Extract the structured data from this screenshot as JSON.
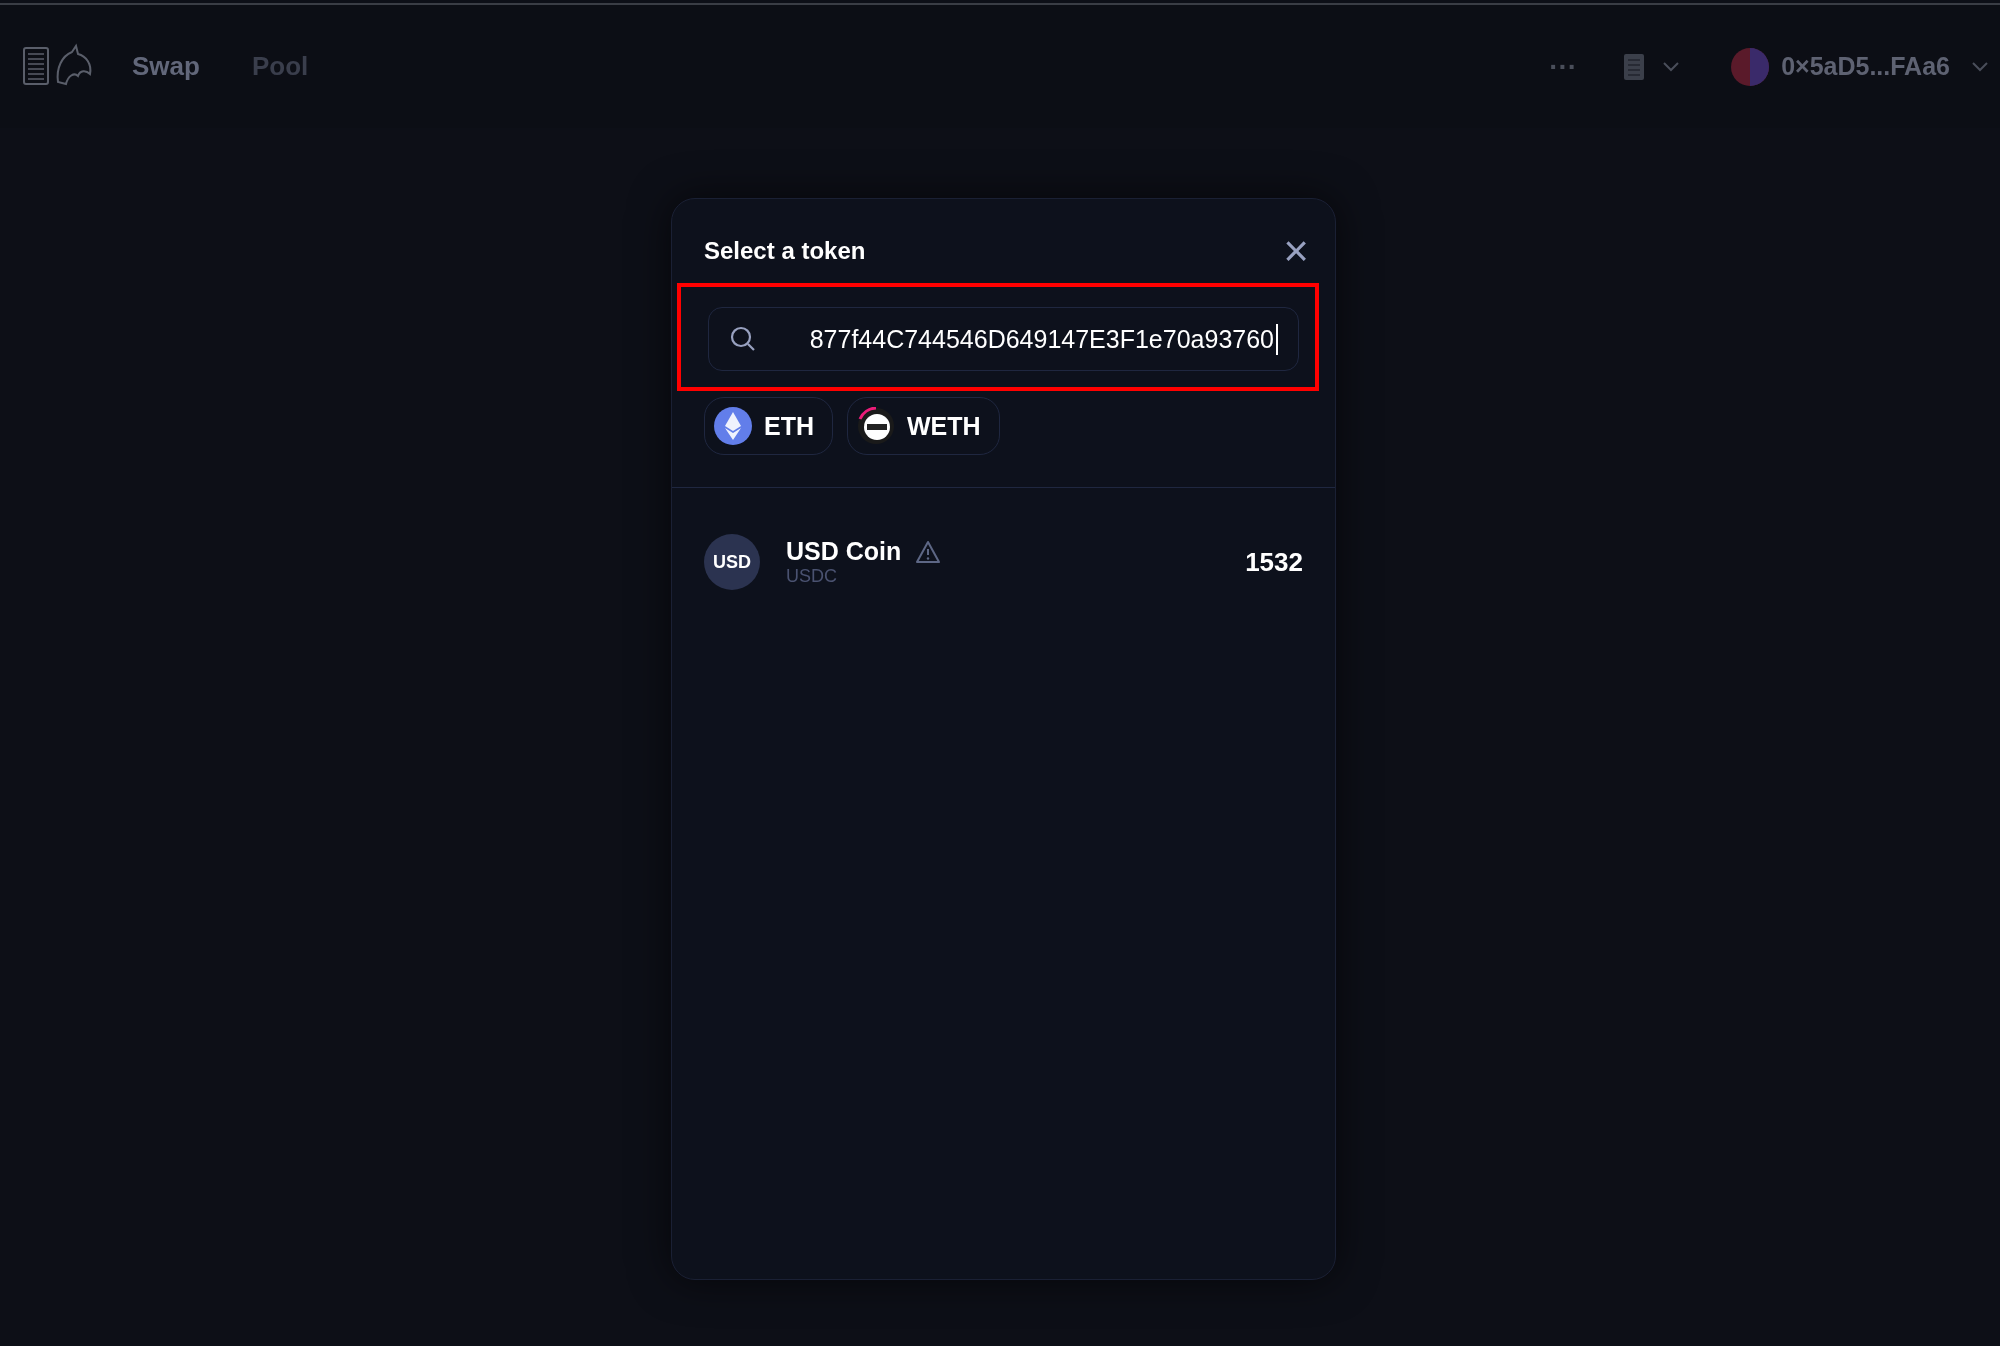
{
  "header": {
    "nav": [
      {
        "label": "Swap",
        "selected": true
      },
      {
        "label": "Pool",
        "selected": false
      }
    ],
    "more": "···",
    "account": {
      "address": "0×5aD5...FAa6"
    }
  },
  "modal": {
    "title": "Select a token",
    "close": "×",
    "search": {
      "value": "877f44C744546D649147E3F1e70a93760",
      "highlighted": true
    },
    "common_tokens": [
      {
        "symbol": "ETH",
        "kind": "eth"
      },
      {
        "symbol": "WETH",
        "kind": "weth"
      }
    ],
    "tokens": [
      {
        "logo_text": "USD",
        "name": "USD Coin",
        "symbol": "USDC",
        "warning": true,
        "balance": "1532"
      }
    ]
  }
}
